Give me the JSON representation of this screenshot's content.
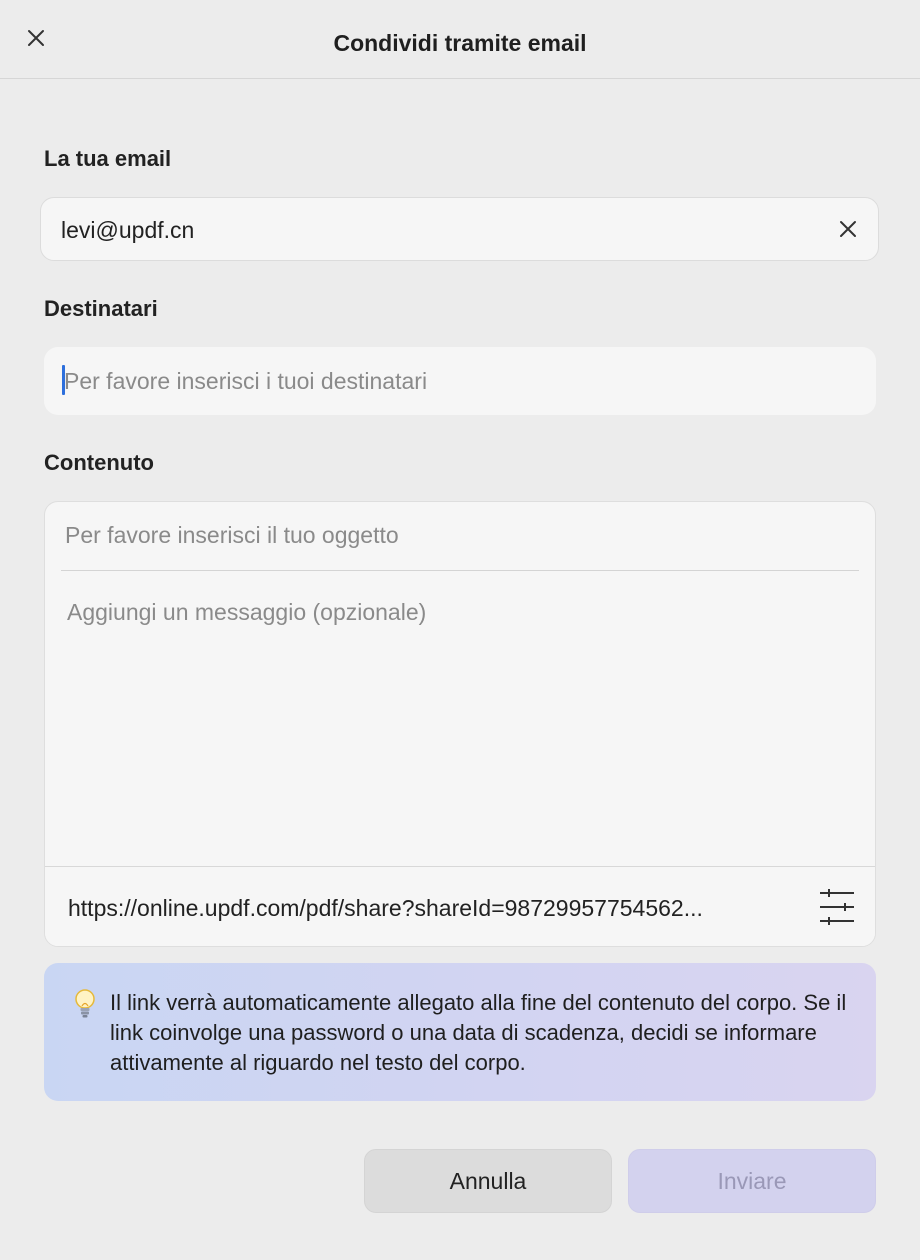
{
  "dialog": {
    "title": "Condividi tramite email"
  },
  "email_section": {
    "label": "La tua email",
    "value": "levi@updf.cn"
  },
  "recipients_section": {
    "label": "Destinatari",
    "placeholder": "Per favore inserisci i tuoi destinatari"
  },
  "content_section": {
    "label": "Contenuto",
    "subject_placeholder": "Per favore inserisci il tuo oggetto",
    "message_placeholder": "Aggiungi un messaggio (opzionale)",
    "link": "https://online.updf.com/pdf/share?shareId=98729957754562..."
  },
  "info": {
    "icon": "lightbulb-icon",
    "text": "Il link verrà automaticamente allegato alla fine del contenuto del corpo. Se il link coinvolge una password o una data di scadenza, decidi se informare attivamente al riguardo nel testo del corpo."
  },
  "buttons": {
    "cancel": "Annulla",
    "send": "Inviare"
  },
  "colors": {
    "accent_caret": "#2d6fdc",
    "send_disabled_bg": "#d3d2ee",
    "info_gradient_start": "#c9d6f3",
    "info_gradient_end": "#d9d4f0"
  }
}
